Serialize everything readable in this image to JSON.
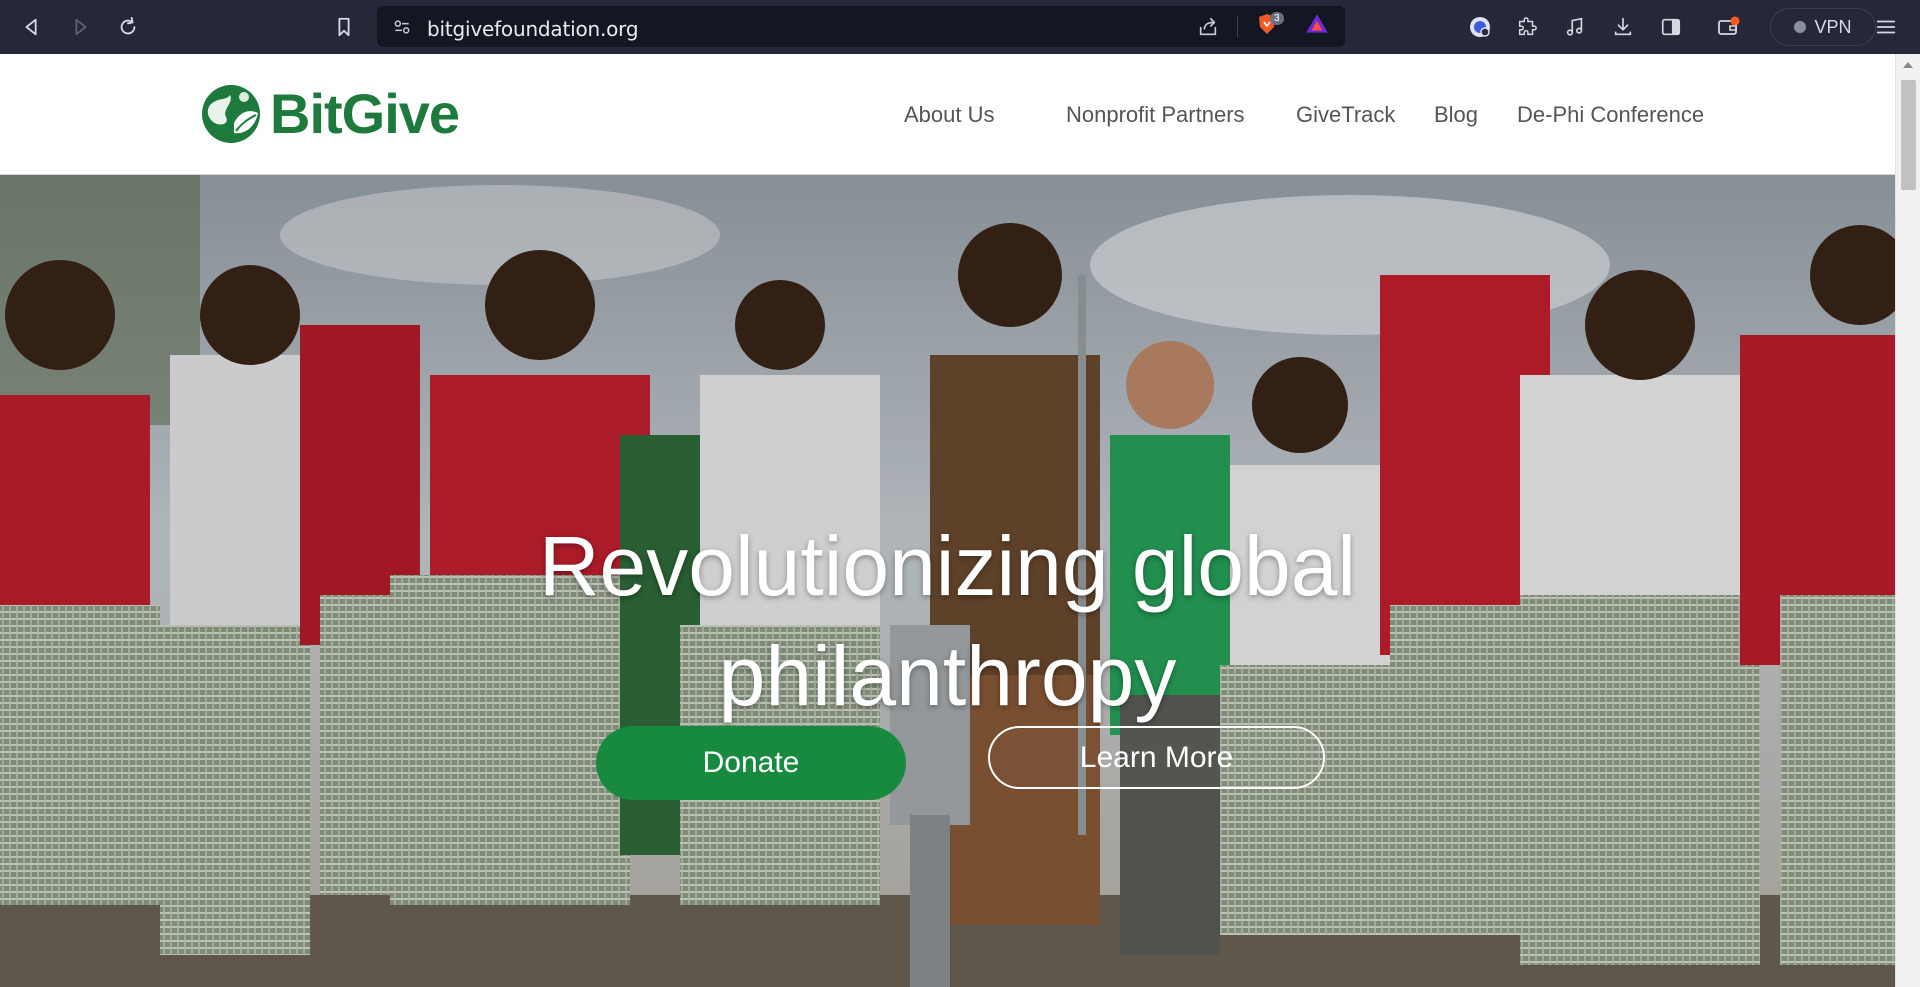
{
  "browser": {
    "url": "bitgivefoundation.org",
    "shields_count": "3",
    "vpn_label": "VPN",
    "icons": [
      "back-icon",
      "forward-icon",
      "reload-icon",
      "bookmark-icon",
      "site-settings-icon",
      "share-icon",
      "brave-shields-icon",
      "brave-rewards-icon",
      "profile-icon",
      "extensions-icon",
      "media-icon",
      "downloads-icon",
      "sidebar-icon",
      "wallet-icon",
      "menu-icon"
    ]
  },
  "site": {
    "logo_text": "BitGive",
    "brand_color": "#1e7a3c",
    "nav": [
      {
        "label": "About Us"
      },
      {
        "label": "Nonprofit Partners"
      },
      {
        "label": "GiveTrack"
      },
      {
        "label": "Blog"
      },
      {
        "label": "De-Phi Conference"
      }
    ]
  },
  "hero": {
    "headline_line1": "Revolutionizing global",
    "headline_line2": "philanthropy",
    "donate_label": "Donate",
    "learn_more_label": "Learn More",
    "donate_color": "#178a40"
  }
}
